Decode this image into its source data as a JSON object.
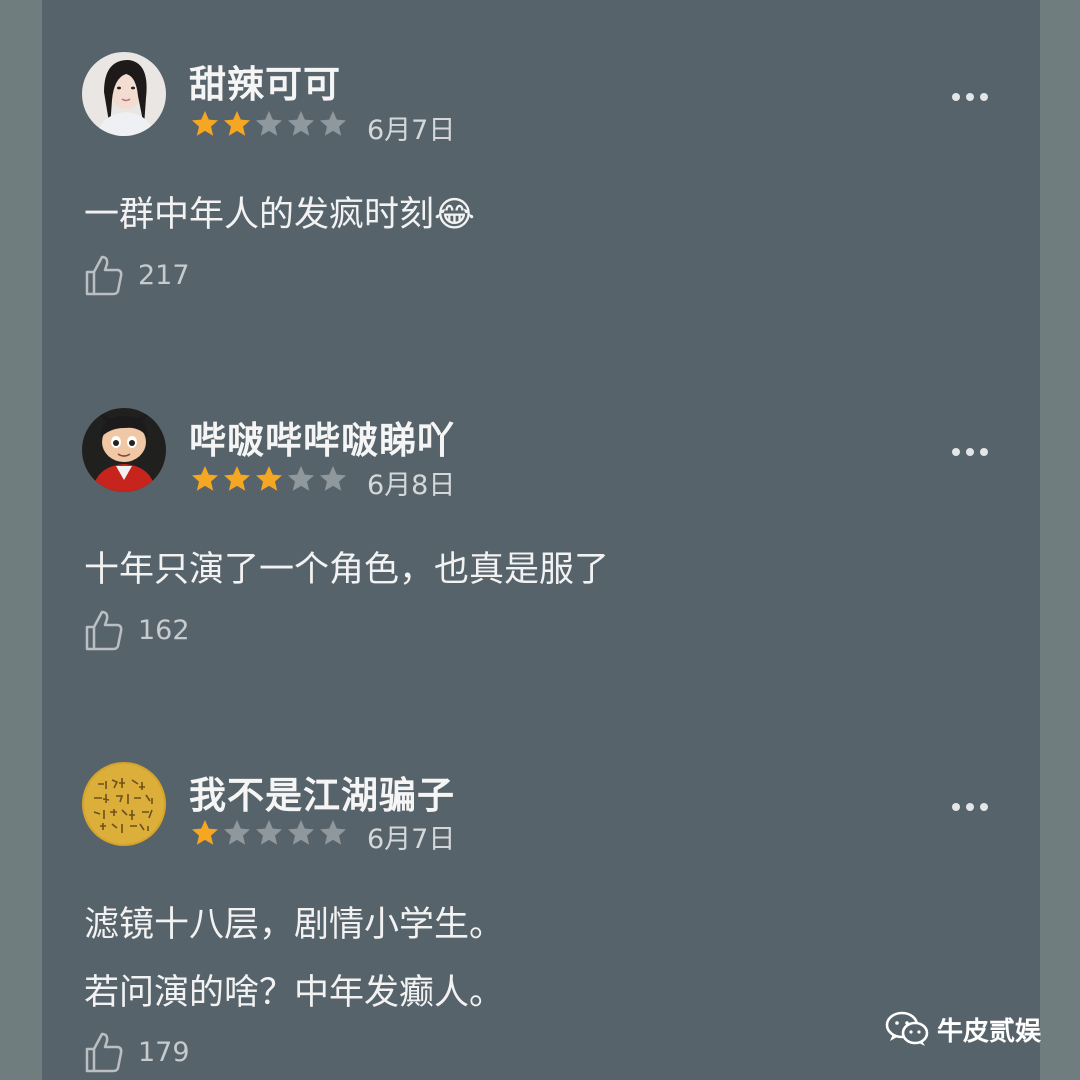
{
  "reviews": [
    {
      "username": "甜辣可可",
      "rating": 2,
      "max_rating": 5,
      "date": "6月7日",
      "text_lines": [
        "一群中年人的发疯时刻😂"
      ],
      "likes": "217"
    },
    {
      "username": "哔啵哔哔啵睇吖",
      "rating": 3,
      "max_rating": 5,
      "date": "6月8日",
      "text_lines": [
        "十年只演了一个角色，也真是服了"
      ],
      "likes": "162"
    },
    {
      "username": "我不是江湖骗子",
      "rating": 1,
      "max_rating": 5,
      "date": "6月7日",
      "text_lines": [
        "滤镜十八层，剧情小学生。",
        "若问演的啥？中年发癫人。"
      ],
      "likes": "179"
    }
  ],
  "watermark": {
    "text": "牛皮贰娱",
    "icon": "wechat-icon"
  },
  "colors": {
    "background": "#57636a",
    "star_filled": "#f5a623",
    "star_empty": "#8f989c"
  },
  "icons": {
    "like": "thumbs-up-icon",
    "more": "more-dots-icon"
  }
}
